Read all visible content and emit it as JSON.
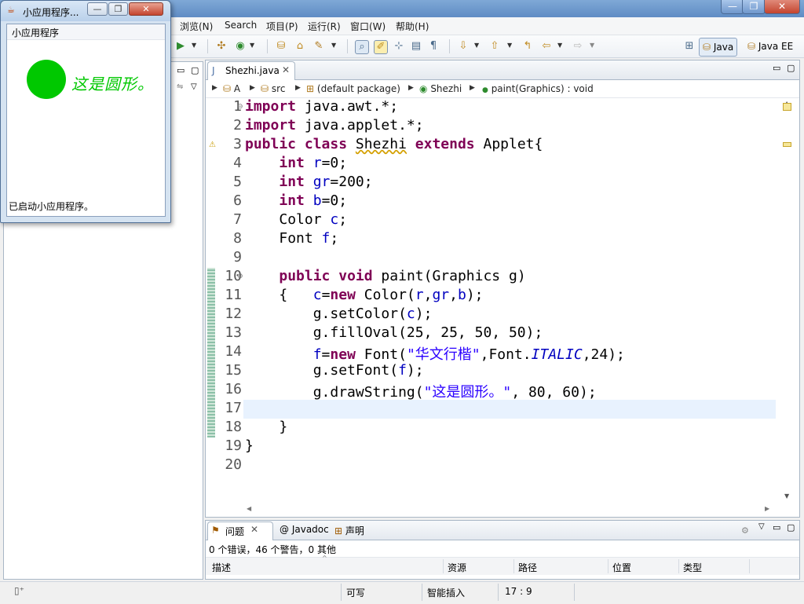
{
  "window": {
    "minimize": "—",
    "restore": "❐",
    "close": "✕"
  },
  "menu": [
    "浏览(N)",
    "Search",
    "项目(P)",
    "运行(R)",
    "窗口(W)",
    "帮助(H)"
  ],
  "perspectives": [
    {
      "label": "Java",
      "active": true
    },
    {
      "label": "Java EE",
      "active": false
    }
  ],
  "editor": {
    "tab_label": "Shezhi.java",
    "breadcrumb": [
      "A",
      "src",
      "(default package)",
      "Shezhi",
      "paint(Graphics) : void"
    ],
    "line_numbers": [
      "1",
      "2",
      "3",
      "4",
      "5",
      "6",
      "7",
      "8",
      "9",
      "10",
      "11",
      "12",
      "13",
      "14",
      "15",
      "16",
      "17",
      "18",
      "19",
      "20"
    ],
    "code": {
      "l1_kw": "import",
      "l1_rest": " java.awt.*;",
      "l2_kw": "import",
      "l2_rest": " java.applet.*;",
      "l3_kw1": "public",
      "l3_kw2": "class",
      "l3_name": "Shezhi",
      "l3_kw3": "extends",
      "l3_rest": " Applet{",
      "l4_kw": "int",
      "l4_var": "r",
      "l4_rest": "=0;",
      "l5_kw": "int",
      "l5_var": "gr",
      "l5_rest": "=200;",
      "l6_kw": "int",
      "l6_var": "b",
      "l6_rest": "=0;",
      "l7_type": "Color ",
      "l7_var": "c",
      "l7_rest": ";",
      "l8_type": "Font ",
      "l8_var": "f",
      "l8_rest": ";",
      "l10_kw1": "public",
      "l10_kw2": "void",
      "l10_rest": " paint(Graphics g)",
      "l11_brace": "{   ",
      "l11_var": "c",
      "l11_eq": "=",
      "l11_kw": "new",
      "l11_ctor": " Color(",
      "l11_a": "r",
      "l11_c1": ",",
      "l11_b": "gr",
      "l11_c2": ",",
      "l11_c": "b",
      "l11_end": ");",
      "l12_pre": "g.setColor(",
      "l12_var": "c",
      "l12_end": ");",
      "l13": "g.fillOval(25, 25, 50, 50);",
      "l14_var": "f",
      "l14_eq": "=",
      "l14_kw": "new",
      "l14_ctor": " Font(",
      "l14_str": "\"华文行楷\"",
      "l14_mid": ",Font.",
      "l14_ital": "ITALIC",
      "l14_end": ",24);",
      "l15_pre": "g.setFont(",
      "l15_var": "f",
      "l15_end": ");",
      "l16_pre": "g.drawString(",
      "l16_str": "\"这是圆形。\"",
      "l16_end": ", 80, 60);",
      "l18": "}",
      "l19": "}"
    }
  },
  "problems": {
    "tabs": [
      "问题",
      "Javadoc",
      "声明"
    ],
    "summary": "0 个错误，46 个警告，0 其他",
    "columns": [
      "描述",
      "资源",
      "路径",
      "位置",
      "类型"
    ]
  },
  "status": {
    "writable": "可写",
    "insert_mode": "智能插入",
    "position": "17 : 9"
  },
  "applet": {
    "title": "小应用程序...",
    "menu": "小应用程序",
    "drawn_text": "这是圆形。",
    "circle_color": "#00c800",
    "status": "已启动小应用程序。"
  },
  "colors": {
    "keyword": "#7f0055",
    "field": "#0000c0",
    "string": "#2a00ff",
    "current_line": "#e8f2fe"
  }
}
